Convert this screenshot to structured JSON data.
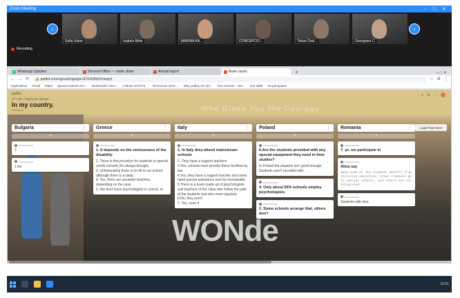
{
  "zoom": {
    "title": "Zoom Meeting",
    "participants": [
      "Sofia Unker",
      "Isabela Mirto",
      "MARINA AN...",
      "CONCEPCIO...",
      "Tirkan Özel...",
      "Georgiana C."
    ],
    "recording": "Recording"
  },
  "browser": {
    "tabs": [
      "Whatsapp Updates",
      "Shrunsd Office — make share",
      "Annual report",
      "Brain courts"
    ],
    "url": "padlet.com/sgrcachnga/gm11011fnl8pl1mzqzyl",
    "bookmarks": [
      "Applications",
      "Gmail",
      "Maps",
      "Special Games Grn...",
      "Bookmarks Yaco...",
      "A Modo Grn/173...",
      "Resources 2013 ...",
      "Why yadley we (20...",
      "Toru Grenan - You...",
      "unn addit",
      "Su panayaurs"
    ]
  },
  "padlet": {
    "brand": "padlet",
    "author_meta": "UT • 4h • Mayla de Horwat",
    "title": "In my country.",
    "subtitle": "Introduce",
    "bg_text": "Who Gives You the Courage",
    "big_word": "WONde",
    "add_post": "Load Post Here",
    "columns": [
      {
        "name": "Bulgaria",
        "cards": [
          {
            "author": "Anonymous",
            "title": "",
            "body": "1."
          },
          {
            "author": "Anonymous",
            "title": "",
            "body": "1.No"
          }
        ]
      },
      {
        "name": "Greece",
        "cards": [
          {
            "author": "Anonymous",
            "title": "1. It depends on the seriousness of the disability",
            "body": "2. There is this provision for students in special needs schools (it's always though)\n3. Unfortunately there is no lift in our school, although there is a ramp.\n4. Yes, there are assistant teachers, depending on the case\n5. We don't have psychologists in school, nt"
          }
        ]
      },
      {
        "name": "Italy",
        "cards": [
          {
            "author": "Anonymous",
            "title": "1. In Italy they attend mainstream schools",
            "body": "2. They have a support teachers\n3.Yes, schools must provide these facilities by law\n4.Yes, they have a support teacher and some need special assistance sent by municipality\n5.There is a team made up of psychologists and teachers of the class who follow the path of the students and who meet regularly\n6.No, they aren't\n7. Yes, even if"
          }
        ]
      },
      {
        "name": "Poland",
        "cards": [
          {
            "author": "Anonymous",
            "title": "6.Are the students provided with any special equipment they need in their studies?",
            "body": "In Poland the situation isn't good enough. Students aren't provided with."
          },
          {
            "author": "Anonymous",
            "title": "4. Only about 50% schools employ psychologists.",
            "body": ""
          },
          {
            "author": "Anonymous",
            "title": "2. Some schools arrange that, others don't",
            "body": ""
          }
        ]
      },
      {
        "name": "Romania",
        "cards": [
          {
            "author": "Anonymous",
            "title": "7. ye, we participate in",
            "body": ""
          },
          {
            "author": "Anonymous",
            "title": "Alina say",
            "body": "many some of the students benefit from inclusive education, other students go to special schools, and others are not integrated",
            "mono": true
          },
          {
            "author": "Anonymous",
            "title": "",
            "body": "Students with disa"
          }
        ]
      }
    ]
  },
  "taskbar": {
    "time": "12:51"
  },
  "colors": {
    "zoom_accent": "#2d8cff",
    "padlet_header": "#d9c48a",
    "taskbar": "#1c2a3a"
  }
}
